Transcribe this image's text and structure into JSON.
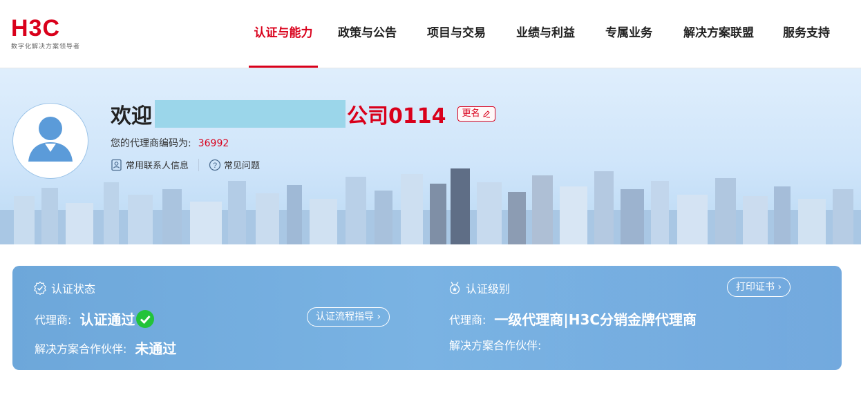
{
  "logo": {
    "mark": "H3C",
    "tagline": "数字化解决方案领导者"
  },
  "nav": [
    {
      "label": "认证与能力",
      "active": true
    },
    {
      "label": "政策与公告"
    },
    {
      "label": "项目与交易"
    },
    {
      "label": "业绩与利益"
    },
    {
      "label": "专属业务"
    },
    {
      "label": "解决方案联盟"
    },
    {
      "label": "服务支持"
    }
  ],
  "banner": {
    "welcome": "欢迎",
    "company_suffix": "公司0114",
    "rename_label": "更名",
    "code_label": "您的代理商编码为:",
    "code_value": "36992",
    "contacts_link": "常用联系人信息",
    "faq_link": "常见问题"
  },
  "status": {
    "title": "认证状态",
    "agent_label": "代理商:",
    "agent_value": "认证通过",
    "guide_button": "认证流程指导",
    "partner_label": "解决方案合作伙伴:",
    "partner_value": "未通过"
  },
  "level": {
    "title": "认证级别",
    "print_button": "打印证书",
    "agent_label": "代理商:",
    "agent_value": "一级代理商|H3C分销金牌代理商",
    "partner_label": "解决方案合作伙伴:"
  },
  "colors": {
    "brand": "#d9001b",
    "card": "#6da7da",
    "check": "#22c33a"
  }
}
